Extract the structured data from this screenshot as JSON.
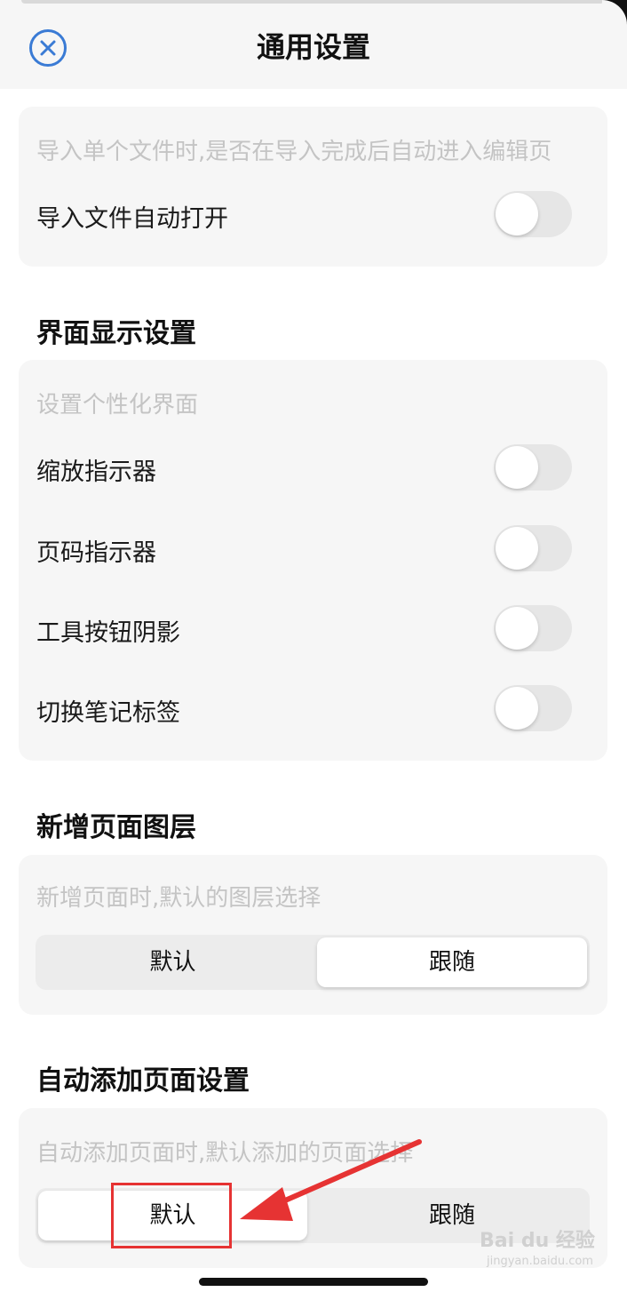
{
  "header": {
    "title": "通用设置",
    "close_icon": "close-circle-icon"
  },
  "import_card": {
    "hint": "导入单个文件时,是否在导入完成后自动进入编辑页",
    "auto_open": {
      "label": "导入文件自动打开",
      "on": false
    }
  },
  "display_section": {
    "title": "界面显示设置",
    "hint": "设置个性化界面",
    "items": [
      {
        "label": "缩放指示器",
        "on": false
      },
      {
        "label": "页码指示器",
        "on": false
      },
      {
        "label": "工具按钮阴影",
        "on": false
      },
      {
        "label": "切换笔记标签",
        "on": false
      }
    ]
  },
  "new_page_layer": {
    "title": "新增页面图层",
    "hint": "新增页面时,默认的图层选择",
    "options": [
      "默认",
      "跟随"
    ],
    "selected": "跟随"
  },
  "auto_add_page": {
    "title": "自动添加页面设置",
    "hint": "自动添加页面时,默认添加的页面选择",
    "options": [
      "默认",
      "跟随"
    ],
    "selected": "默认"
  },
  "annotation": {
    "highlight_color": "#e63333"
  },
  "watermark": {
    "brand": "Bai du 经验",
    "domain": "jingyan.baidu.com"
  },
  "colors": {
    "accent": "#3a7bd5",
    "card_bg": "#f6f6f6",
    "hint_text": "#c4c4c4"
  }
}
